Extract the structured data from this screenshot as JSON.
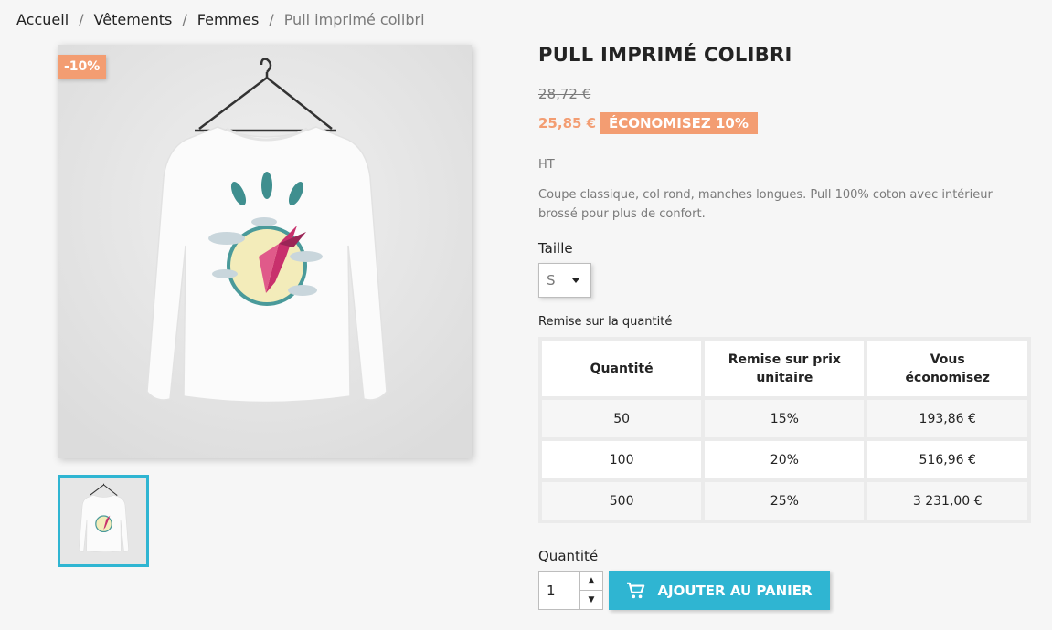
{
  "breadcrumb": {
    "home": "Accueil",
    "level1": "Vêtements",
    "level2": "Femmes",
    "current": "Pull imprimé colibri"
  },
  "product": {
    "discount_flag": "-10%",
    "title": "PULL IMPRIMÉ COLIBRI",
    "regular_price": "28,72 €",
    "current_price": "25,85 €",
    "save_label": "ÉCONOMISEZ 10%",
    "tax_label": "HT",
    "description": "Coupe classique, col rond, manches longues. Pull 100% coton avec intérieur brossé pour plus de confort."
  },
  "size": {
    "label": "Taille",
    "selected": "S"
  },
  "quantity_discount": {
    "label": "Remise sur la quantité",
    "headers": [
      "Quantité",
      "Remise sur prix unitaire",
      "Vous économisez"
    ],
    "rows": [
      [
        "50",
        "15%",
        "193,86 €"
      ],
      [
        "100",
        "20%",
        "516,96 €"
      ],
      [
        "500",
        "25%",
        "3 231,00 €"
      ]
    ]
  },
  "quantity": {
    "label": "Quantité",
    "value": "1"
  },
  "cart": {
    "add_label": "AJOUTER AU PANIER"
  },
  "colors": {
    "accent": "#2fb5d2",
    "discount": "#f39d72"
  },
  "icons": {
    "cart": "shopping-cart-icon",
    "select": "caret-down-icon",
    "spin_up": "chevron-up-icon",
    "spin_down": "chevron-down-icon"
  }
}
